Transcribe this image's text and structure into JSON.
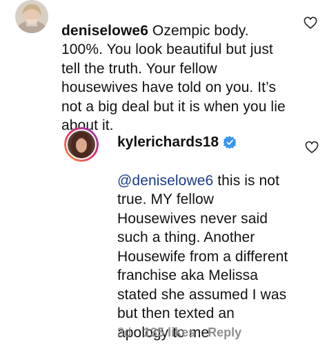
{
  "comment1": {
    "username": "deniselowe6",
    "text": " Ozempic body.\n100%. You look beautiful but just\ntell the truth. Your fellow\nhousewives have told on you. It’s\nnot a big deal but it is when you lie\nabout it.",
    "avatar_icon": "user-avatar-photo",
    "like_icon": "heart-outline-icon"
  },
  "comment2": {
    "username": "kylerichards18",
    "verified_icon": "verified-badge-icon",
    "mention": "@deniselowe6",
    "text": " this is not\ntrue. MY fellow\nHousewives never said\nsuch a thing. Another\nHousewife from a different\nfranchise aka Melissa\nstated she assumed I was\nbut then texted an\napology to me",
    "avatar_icon": "user-avatar-photo",
    "like_icon": "heart-outline-icon",
    "time": "3d",
    "likes": "135 likes",
    "reply_label": "Reply"
  },
  "colors": {
    "text": "#111111",
    "meta": "#8e8e8e",
    "verified": "#3897f0",
    "mention": "#1a3a8a"
  }
}
